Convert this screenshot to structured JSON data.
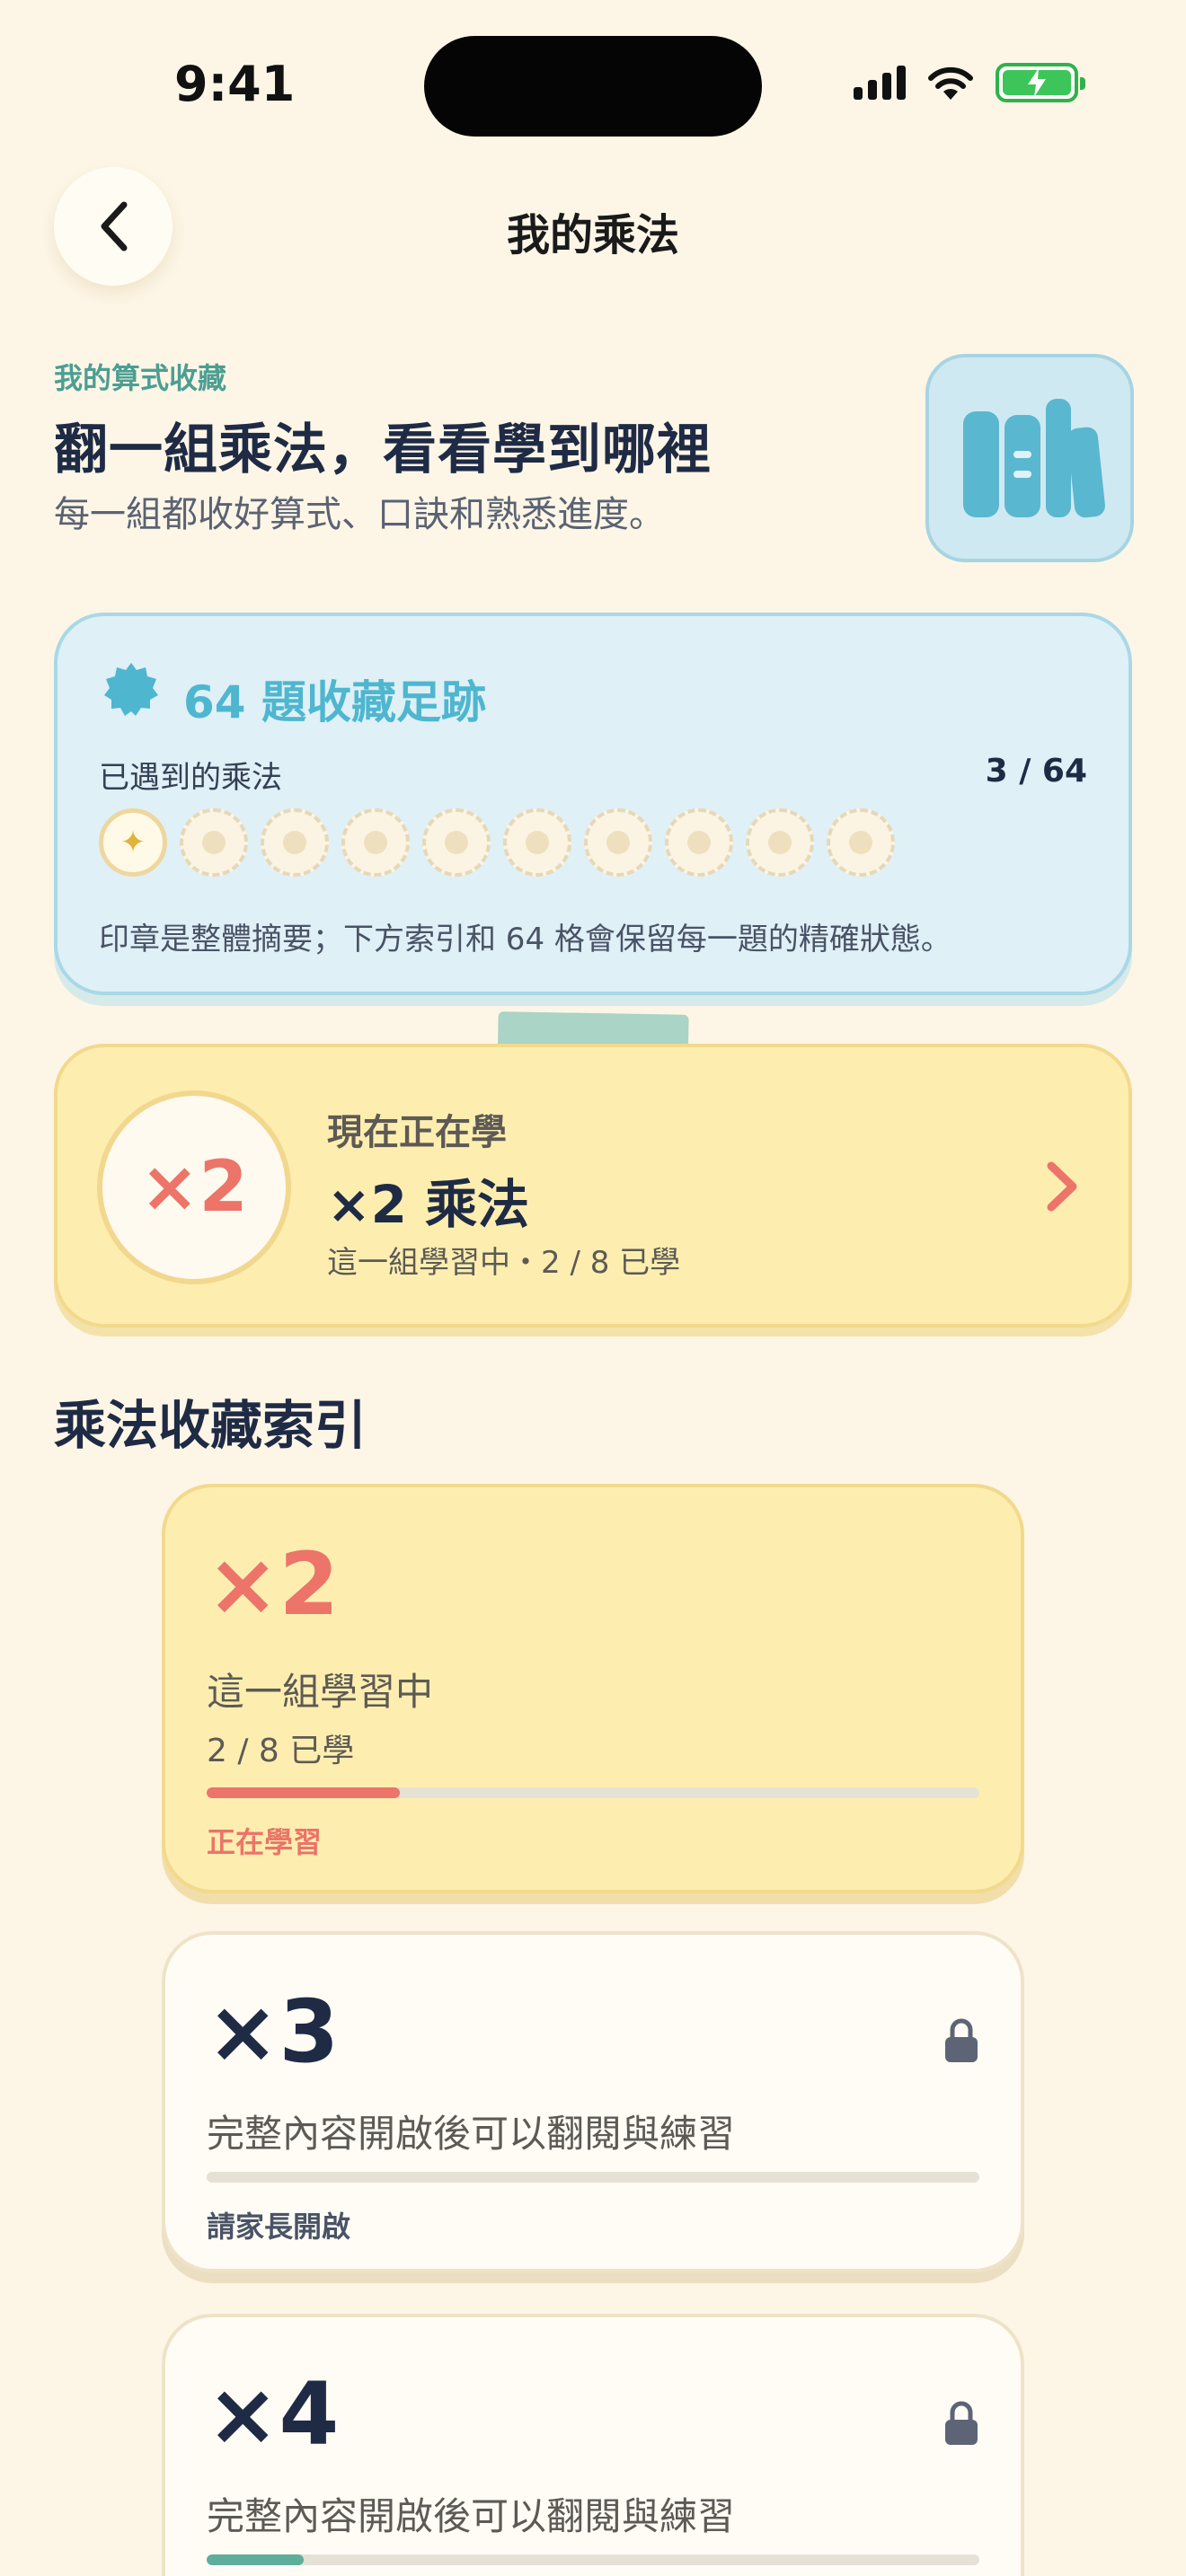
{
  "status_bar": {
    "time": "9:41"
  },
  "nav": {
    "title": "我的乘法"
  },
  "header": {
    "eyebrow": "我的算式收藏",
    "headline": "翻一組乘法，看看學到哪裡",
    "subhead": "每一組都收好算式、口訣和熟悉進度。",
    "icon": "books-icon"
  },
  "stamp_card": {
    "title": "64 題收藏足跡",
    "seen_label": "已遇到的乘法",
    "seen_count": "3 / 64",
    "stamps_total": 10,
    "stamps_active": 1,
    "note": "印章是整體摘要；下方索引和 64 格會保留每一題的精確狀態。"
  },
  "current": {
    "badge": "×2",
    "kicker": "現在正在學",
    "title": "×2 乘法",
    "progress": "這一組學習中・2 / 8 已學"
  },
  "section": {
    "title": "乘法收藏索引"
  },
  "tables": [
    {
      "name": "×2",
      "desc": "這一組學習中",
      "progress": "2 / 8 已學",
      "status": "正在學習",
      "fraction": 0.25,
      "bar_color": "#ec7469",
      "locked": false
    },
    {
      "name": "×3",
      "desc": "完整內容開啟後可以翻閱與練習",
      "status": "請家長開啟",
      "fraction": 0,
      "bar_color": "#5fae9c",
      "locked": true
    },
    {
      "name": "×4",
      "desc": "完整內容開啟後可以翻閱與練習",
      "fraction": 0.125,
      "bar_color": "#5fae9c",
      "locked": true
    }
  ],
  "colors": {
    "accent": "#ec7469",
    "teal": "#4fb6cf",
    "navy": "#1f2b45",
    "background": "#fdf6e6"
  }
}
